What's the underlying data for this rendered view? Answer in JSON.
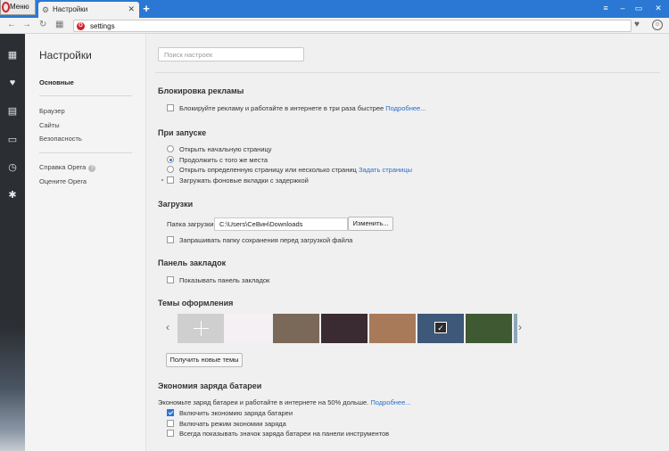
{
  "window": {
    "menu_label": "Меню",
    "tab_title": "Настройки",
    "new_tab": "+",
    "controls": [
      "≡",
      "–",
      "▭",
      "✕"
    ]
  },
  "addressbar": {
    "url": "settings",
    "badge": "O"
  },
  "settings_nav": {
    "title": "Настройки",
    "items": [
      "Основные",
      "Браузер",
      "Сайты",
      "Безопасность",
      "Справка Opera",
      "Оцените Opera"
    ]
  },
  "search": {
    "placeholder": "Поиск настроек"
  },
  "adblock": {
    "title": "Блокировка рекламы",
    "option": "Блокируйте рекламу и работайте в интернете в три раза быстрее",
    "link": "Подробнее..."
  },
  "startup": {
    "title": "При запуске",
    "options": [
      "Открыть начальную страницу",
      "Продолжить с того же места",
      "Открыть определенную страницу или несколько страниц"
    ],
    "selected_index": 1,
    "set_pages_link": "Задать страницы",
    "delay_option": "Загружать фоновые вкладки с задержкой"
  },
  "downloads": {
    "title": "Загрузки",
    "folder_label": "Папка загрузки:",
    "folder_path": "C:\\Users\\СеВин\\Downloads",
    "change_button": "Изменить...",
    "ask_option": "Запрашивать папку сохранения перед загрузкой файла"
  },
  "bookmarks_bar": {
    "title": "Панель закладок",
    "option": "Показывать панель закладок"
  },
  "themes": {
    "title": "Темы оформления",
    "get_more_button": "Получить новые темы",
    "colors": [
      "#cfcfcf",
      "#f5f0f3",
      "#7a6858",
      "#3a2a32",
      "#a87a5a",
      "#3d5878",
      "#3f5a32",
      "#8aa8b8"
    ],
    "selected_index": 5
  },
  "battery": {
    "title": "Экономия заряда батареи",
    "description": "Экономьте заряд батареи и работайте в интернете на 50% дольше.",
    "link": "Подробнее...",
    "options": [
      "Включить экономию заряда батареи",
      "Включать режим экономии заряда",
      "Всегда показывать значок заряда батареи на панели инструментов"
    ],
    "checked": [
      true,
      false,
      false
    ]
  }
}
